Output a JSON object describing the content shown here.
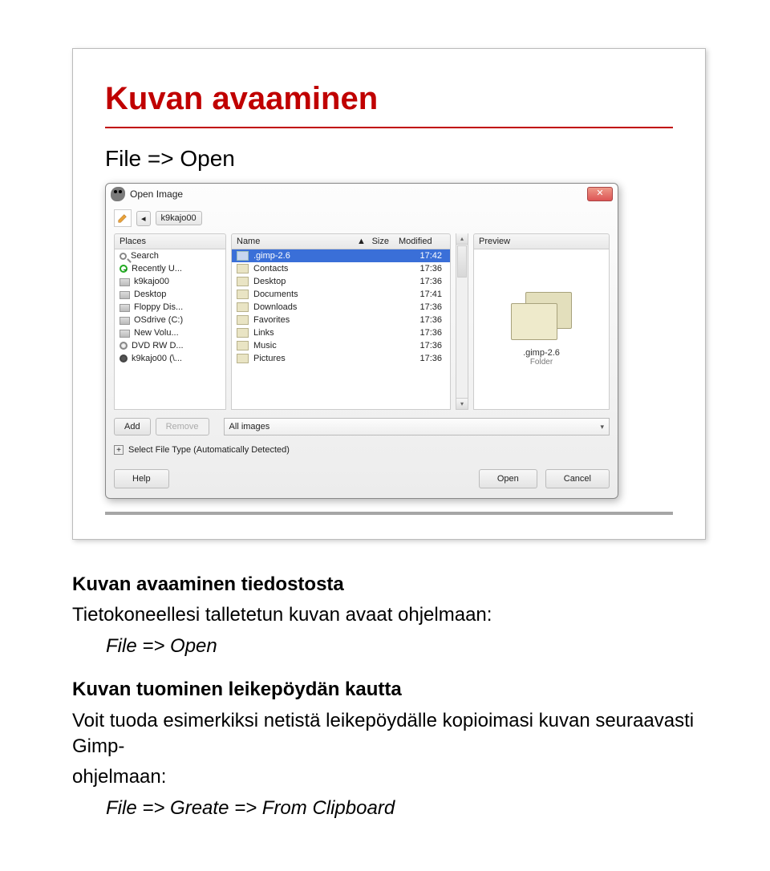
{
  "title": "Kuvan avaaminen",
  "subtitle": "File => Open",
  "dialog": {
    "titlebar_icon": "gimp-wilber-icon",
    "window_title": "Open Image",
    "close_label": "✕",
    "path_segment": "k9kajo00",
    "path_caret": "◂",
    "places_header": "Places",
    "name_header": "Name",
    "size_header": "Size",
    "modified_header": "Modified",
    "sort_arrow": "▲",
    "preview_header": "Preview",
    "places": [
      {
        "icon": "search",
        "label": "Search"
      },
      {
        "icon": "clock",
        "label": "Recently U..."
      },
      {
        "icon": "drive",
        "label": "k9kajo00"
      },
      {
        "icon": "drive",
        "label": "Desktop"
      },
      {
        "icon": "drive",
        "label": "Floppy Dis..."
      },
      {
        "icon": "drive",
        "label": "OSdrive (C:)"
      },
      {
        "icon": "drive",
        "label": "New Volu..."
      },
      {
        "icon": "cd",
        "label": "DVD RW D..."
      },
      {
        "icon": "cdneg",
        "label": "k9kajo00 (\\..."
      }
    ],
    "files": [
      {
        "name": ".gimp-2.6",
        "size": "",
        "mod": "17:42",
        "selected": true
      },
      {
        "name": "Contacts",
        "size": "",
        "mod": "17:36",
        "selected": false
      },
      {
        "name": "Desktop",
        "size": "",
        "mod": "17:36",
        "selected": false
      },
      {
        "name": "Documents",
        "size": "",
        "mod": "17:41",
        "selected": false
      },
      {
        "name": "Downloads",
        "size": "",
        "mod": "17:36",
        "selected": false
      },
      {
        "name": "Favorites",
        "size": "",
        "mod": "17:36",
        "selected": false
      },
      {
        "name": "Links",
        "size": "",
        "mod": "17:36",
        "selected": false
      },
      {
        "name": "Music",
        "size": "",
        "mod": "17:36",
        "selected": false
      },
      {
        "name": "Pictures",
        "size": "",
        "mod": "17:36",
        "selected": false
      }
    ],
    "preview_name": ".gimp-2.6",
    "preview_kind": "Folder",
    "add_label": "Add",
    "remove_label": "Remove",
    "filter_label": "All images",
    "sft_label": "Select File Type (Automatically Detected)",
    "help_label": "Help",
    "open_label": "Open",
    "cancel_label": "Cancel",
    "expand_symbol": "+"
  },
  "body": {
    "h1": "Kuvan avaaminen tiedostosta",
    "p1": "Tietokoneellesi talletetun kuvan avaat ohjelmaan:",
    "cmd1": "File => Open",
    "h2": "Kuvan tuominen leikepöydän kautta",
    "p2a": "Voit tuoda esimerkiksi netistä leikepöydälle kopioimasi kuvan seuraavasti Gimp-",
    "p2b": "ohjelmaan:",
    "cmd2": "File => Greate => From Clipboard"
  }
}
